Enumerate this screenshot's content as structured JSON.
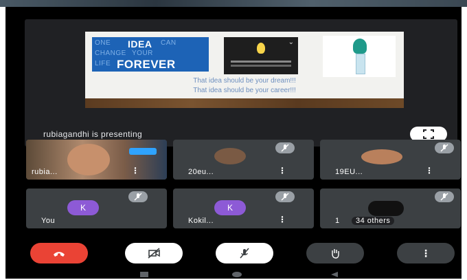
{
  "presentation": {
    "slide": {
      "slogan_lines": [
        "ONE",
        "IDEA",
        "CAN",
        "CHANGE",
        "YOUR",
        "LIFE",
        "FOREVER"
      ],
      "caption_line1": "That idea should be your dream!!!",
      "caption_line2": "That idea should be your career!!!"
    },
    "presenting_text": "rubiagandhi is presenting",
    "fullscreen_icon": "fullscreen-icon"
  },
  "participants": [
    {
      "name": "rubia...",
      "type": "video"
    },
    {
      "name": "20eu...",
      "type": "photo"
    },
    {
      "name": "19EU...",
      "type": "photo"
    },
    {
      "name": "You",
      "initial": "K"
    },
    {
      "name": "Kokil...",
      "initial": "K"
    },
    {
      "name": "34 others",
      "count_prefix": "1"
    }
  ],
  "icons": {
    "mic_off": "mic-off-icon",
    "more": "more-vertical-icon",
    "end_call": "end-call-icon",
    "camera_off": "camera-off-icon",
    "raise_hand": "raise-hand-icon"
  },
  "colors": {
    "end_call": "#ea4335",
    "avatar": "#8d5ad6",
    "tile": "#3c4043",
    "stage": "#202124"
  }
}
